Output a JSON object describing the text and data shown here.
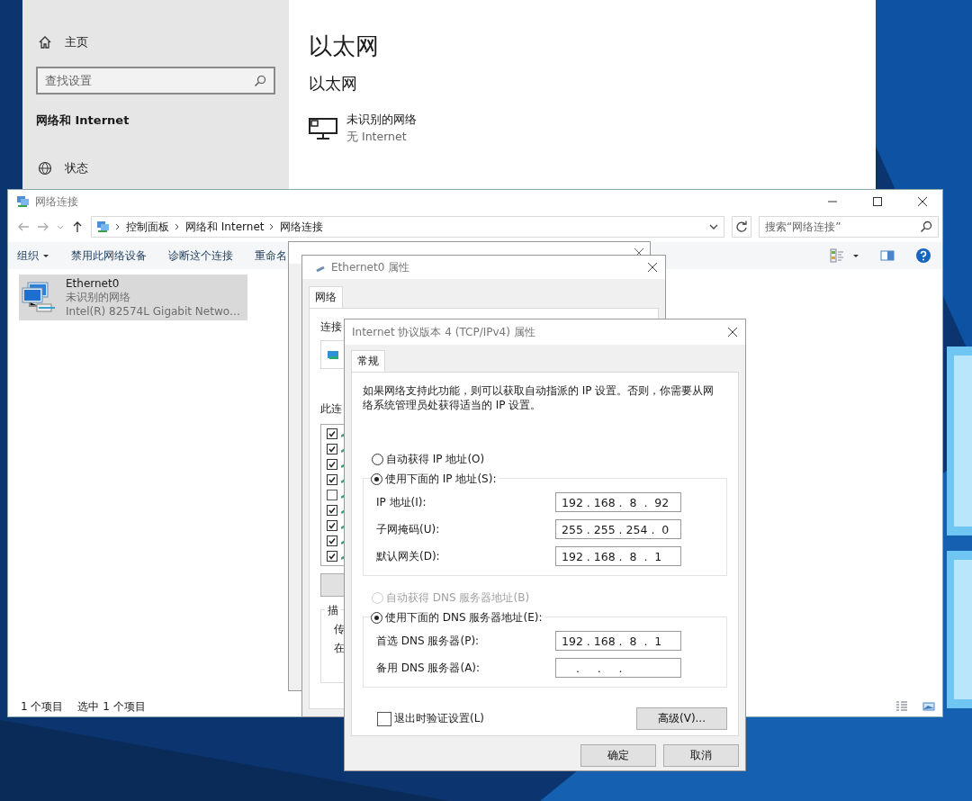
{
  "settings": {
    "home": "主页",
    "search": {
      "placeholder": "查找设置"
    },
    "section": "网络和 Internet",
    "nav_items": [
      {
        "label": "状态"
      }
    ],
    "page_title": "以太网",
    "subheading": "以太网",
    "network": {
      "name": "未识别的网络",
      "status": "无 Internet"
    }
  },
  "explorer": {
    "title": "网络连接",
    "breadcrumb": [
      "控制面板",
      "网络和 Internet",
      "网络连接"
    ],
    "search": {
      "placeholder": "搜索“网络连接”"
    },
    "toolbar": [
      {
        "label": "组织",
        "dropdown": true
      },
      {
        "label": "禁用此网络设备",
        "dropdown": false
      },
      {
        "label": "诊断这个连接",
        "dropdown": false
      },
      {
        "label": "重命名",
        "dropdown": false
      }
    ],
    "connections": [
      {
        "name": "Ethernet0",
        "status": "未识别的网络",
        "device": "Intel(R) 82574L Gigabit Netwo…",
        "selected": true
      }
    ],
    "status_bar": [
      "1 个项目",
      "选中 1 个项目"
    ]
  },
  "properties": {
    "title": "Ethernet0 属性",
    "tab": "网络",
    "connect_label": "连接",
    "items_label": "此连",
    "items": [
      {
        "checked": true
      },
      {
        "checked": true
      },
      {
        "checked": true
      },
      {
        "checked": true
      },
      {
        "checked": false
      },
      {
        "checked": true
      },
      {
        "checked": true
      },
      {
        "checked": true
      },
      {
        "checked": true
      }
    ],
    "description_label": "描",
    "description_lines": [
      "传",
      "在"
    ]
  },
  "tcpip": {
    "title": "Internet 协议版本 4 (TCP/IPv4) 属性",
    "tab": "常规",
    "intro": "如果网络支持此功能，则可以获取自动指派的 IP 设置。否则，你需要从网络系统管理员处获得适当的 IP 设置。",
    "ip_modes": [
      {
        "label": "自动获得 IP 地址(O)",
        "selected": false,
        "disabled": false
      },
      {
        "label": "使用下面的 IP 地址(S):",
        "selected": true,
        "disabled": false
      }
    ],
    "ip_fields": [
      {
        "label": "IP 地址(I):",
        "value": "192 . 168 .  8  .  92"
      },
      {
        "label": "子网掩码(U):",
        "value": "255 . 255 . 254 .  0"
      },
      {
        "label": "默认网关(D):",
        "value": "192 . 168 .  8  .  1"
      }
    ],
    "dns_modes": [
      {
        "label": "自动获得 DNS 服务器地址(B)",
        "selected": false,
        "disabled": true
      },
      {
        "label": "使用下面的 DNS 服务器地址(E):",
        "selected": true,
        "disabled": false
      }
    ],
    "dns_fields": [
      {
        "label": "首选 DNS 服务器(P):",
        "value": "192 . 168 .  8  .  1"
      },
      {
        "label": "备用 DNS 服务器(A):",
        "value": "    .     .     ."
      }
    ],
    "validate": {
      "label": "退出时验证设置(L)",
      "checked": false
    },
    "advanced": "高级(V)...",
    "buttons": [
      "确定",
      "取消"
    ]
  }
}
